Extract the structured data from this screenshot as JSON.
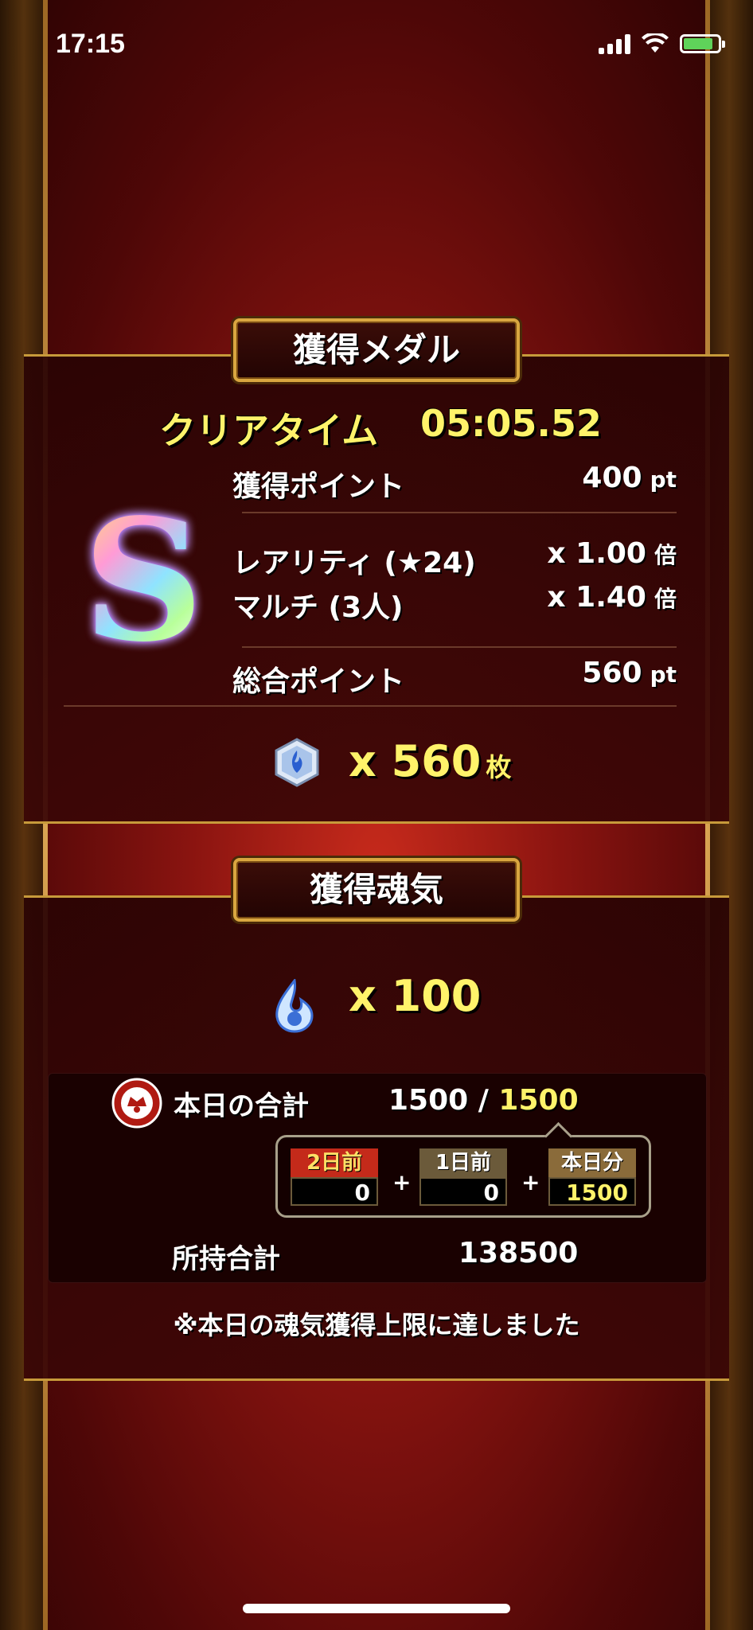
{
  "status_bar": {
    "time": "17:15"
  },
  "medal_section": {
    "title": "獲得メダル",
    "clear_time_label": "クリアタイム",
    "clear_time_value": "05:05.52",
    "rank": "S",
    "earned_points_label": "獲得ポイント",
    "earned_points_value": "400",
    "pt_unit": "pt",
    "rarity_label": "レアリティ (★24)",
    "rarity_value": "x 1.00",
    "multi_label": "マルチ (3人)",
    "multi_value": "x 1.40",
    "multiplier_unit": "倍",
    "total_points_label": "総合ポイント",
    "total_points_value": "560",
    "medal_count": "x 560",
    "medal_unit": "枚"
  },
  "soul_section": {
    "title": "獲得魂気",
    "soul_count": "x 100",
    "today_total_label": "本日の合計",
    "today_total_current": "1500",
    "today_total_separator": " / ",
    "today_total_cap": "1500",
    "breakdown": [
      {
        "label": "2日前",
        "value": "0"
      },
      {
        "label": "1日前",
        "value": "0"
      },
      {
        "label": "本日分",
        "value": "1500"
      }
    ],
    "plus": "+",
    "owned_total_label": "所持合計",
    "owned_total_value": "138500",
    "notice": "※本日の魂気獲得上限に達しました"
  },
  "colors": {
    "accent_yellow": "#fff36a",
    "gold_border": "#c79a3a",
    "background_red": "#8a1410"
  }
}
